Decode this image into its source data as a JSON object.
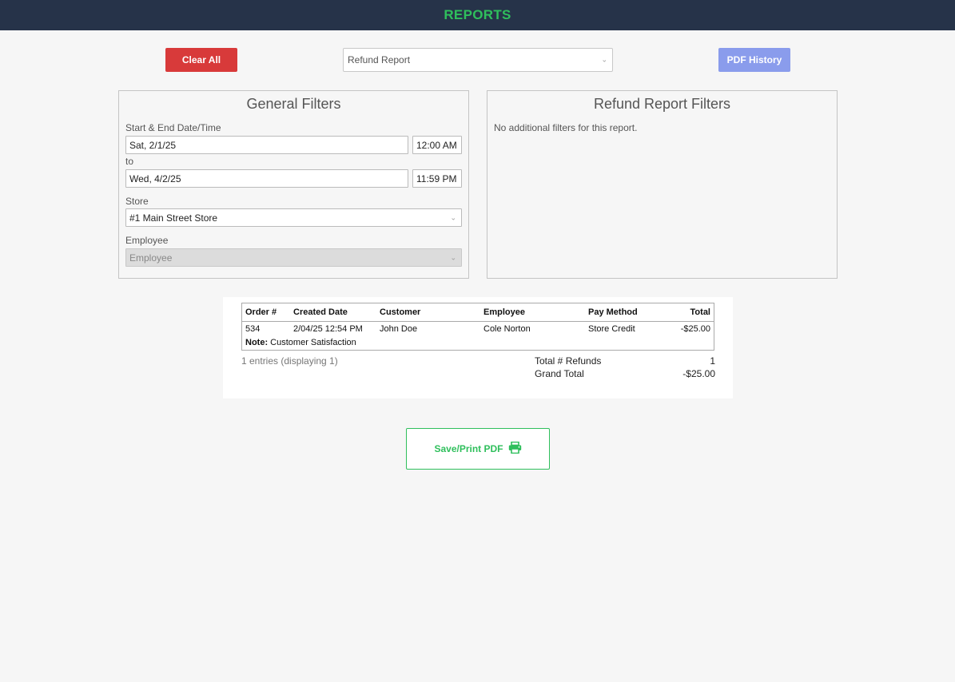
{
  "header": {
    "title": "REPORTS"
  },
  "toolbar": {
    "clear_label": "Clear All",
    "report_select": "Refund Report",
    "pdf_history_label": "PDF History"
  },
  "general_filters": {
    "title": "General Filters",
    "date_label": "Start & End Date/Time",
    "start_date": "Sat, 2/1/25",
    "start_time": "12:00 AM",
    "to_label": "to",
    "end_date": "Wed, 4/2/25",
    "end_time": "11:59 PM",
    "store_label": "Store",
    "store_value": "#1 Main Street Store",
    "employee_label": "Employee",
    "employee_placeholder": "Employee"
  },
  "refund_filters": {
    "title": "Refund Report Filters",
    "message": "No additional filters for this report."
  },
  "table": {
    "columns": [
      "Order #",
      "Created Date",
      "Customer",
      "Employee",
      "Pay Method",
      "Total"
    ],
    "rows": [
      {
        "order": "534",
        "created": "2/04/25 12:54 PM",
        "customer": "John Doe",
        "employee": "Cole Norton",
        "pay_method": "Store Credit",
        "total": "-$25.00",
        "note_label": "Note:",
        "note": "Customer Satisfaction"
      }
    ]
  },
  "summary": {
    "entries": "1 entries (displaying 1)",
    "total_refunds_label": "Total # Refunds",
    "total_refunds_value": "1",
    "grand_total_label": "Grand Total",
    "grand_total_value": "-$25.00"
  },
  "save_button": {
    "label": "Save/Print PDF",
    "icon": "printer-icon"
  },
  "colors": {
    "header_bg": "#263349",
    "accent_green": "#2fbf5c",
    "clear_red": "#d83a3a",
    "pdf_history_blue": "#8a9cec"
  }
}
